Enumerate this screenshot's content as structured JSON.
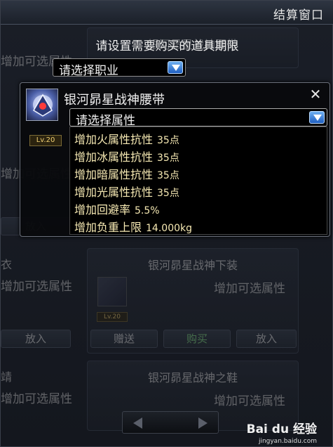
{
  "window": {
    "title": "结算窗口"
  },
  "instruction": "请设置需要购买的道具期限",
  "job_select": {
    "label": "请选择职业"
  },
  "item": {
    "name": "银河昴星战神腰带",
    "level": "Lv.20",
    "attr_select": {
      "label": "请选择属性"
    },
    "attributes": [
      {
        "label": "增加火属性抗性",
        "value": "35点"
      },
      {
        "label": "增加冰属性抗性",
        "value": "35点"
      },
      {
        "label": "增加暗属性抗性",
        "value": "35点"
      },
      {
        "label": "增加光属性抗性",
        "value": "35点"
      },
      {
        "label": "增加回避率",
        "value": "5.5%"
      },
      {
        "label": "增加负重上限",
        "value": "14.000kg"
      }
    ]
  },
  "background": {
    "add_attr": "增加可选属性",
    "card_top": {
      "title": "银河昴星战神腰带"
    },
    "card_mid": {
      "title": "银河昴星战神下装",
      "level": "Lv.20"
    },
    "card_bottom": {
      "title": "银河昴星战神之鞋"
    },
    "left_names": [
      "衣",
      "靖"
    ],
    "buttons": {
      "put_in": "放入",
      "gift": "赠送",
      "buy": "购买"
    }
  },
  "watermark": {
    "brand": "Bai du 经验",
    "url": "jingyan.baidu.com"
  },
  "colors": {
    "attr_text": "#f6e9b3",
    "arrow_blue": "#1f5ec0",
    "buy_green": "#7fd37f"
  },
  "icons": {
    "dropdown": "chevron-down-icon",
    "close": "close-icon",
    "prev": "arrow-left-icon",
    "next": "arrow-right-icon",
    "item": "belt-item-icon"
  }
}
